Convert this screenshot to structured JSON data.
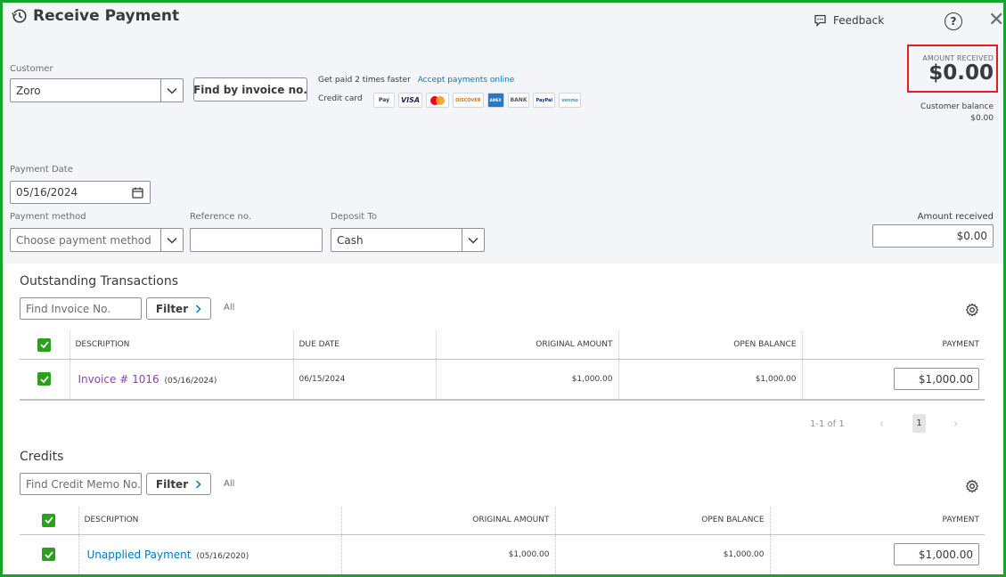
{
  "header": {
    "title": "Receive Payment",
    "feedback_label": "Feedback",
    "help_label": "?",
    "close_label": "✕"
  },
  "amount_summary": {
    "label": "AMOUNT RECEIVED",
    "value": "$0.00",
    "customer_balance_label": "Customer balance",
    "customer_balance_value": "$0.00"
  },
  "customer": {
    "label": "Customer",
    "value": "Zoro",
    "find_invoice_button": "Find by invoice no."
  },
  "payments_promo": {
    "text": "Get paid 2 times faster",
    "link": "Accept payments online",
    "credit_card_label": "Credit card",
    "logos": [
      "Pay",
      "VISA",
      "",
      "DISCOVER",
      "AMEX",
      "BANK",
      "PayPal",
      "venmo"
    ]
  },
  "payment_date": {
    "label": "Payment Date",
    "value": "05/16/2024"
  },
  "payment_method": {
    "label": "Payment method",
    "placeholder": "Choose payment method"
  },
  "reference": {
    "label": "Reference no.",
    "value": ""
  },
  "deposit_to": {
    "label": "Deposit To",
    "value": "Cash"
  },
  "amount_received_field": {
    "label": "Amount received",
    "value": "$0.00"
  },
  "outstanding": {
    "title": "Outstanding Transactions",
    "search_placeholder": "Find Invoice No.",
    "filter_label": "Filter",
    "filter_value": "All",
    "columns": [
      "DESCRIPTION",
      "DUE DATE",
      "ORIGINAL AMOUNT",
      "OPEN BALANCE",
      "PAYMENT"
    ],
    "rows": [
      {
        "description": "Invoice # 1016",
        "date": "(05/16/2024)",
        "due_date": "06/15/2024",
        "original": "$1,000.00",
        "open_balance": "$1,000.00",
        "payment": "$1,000.00"
      }
    ],
    "pager": {
      "range": "1-1 of 1",
      "prev": "‹",
      "page": "1",
      "next": "›"
    }
  },
  "credits": {
    "title": "Credits",
    "search_placeholder": "Find Credit Memo No.",
    "filter_label": "Filter",
    "filter_value": "All",
    "columns": [
      "DESCRIPTION",
      "ORIGINAL AMOUNT",
      "OPEN BALANCE",
      "PAYMENT"
    ],
    "rows": [
      {
        "description": "Unapplied Payment",
        "date": "(05/16/2020)",
        "original": "$1,000.00",
        "open_balance": "$1,000.00",
        "payment": "$1,000.00"
      }
    ]
  },
  "colors": {
    "frame": "#18a32b",
    "highlight_box": "#e02020",
    "checkbox": "#2ca01c",
    "invoice_link": "#8d44ad",
    "credit_link": "#0077c5"
  }
}
